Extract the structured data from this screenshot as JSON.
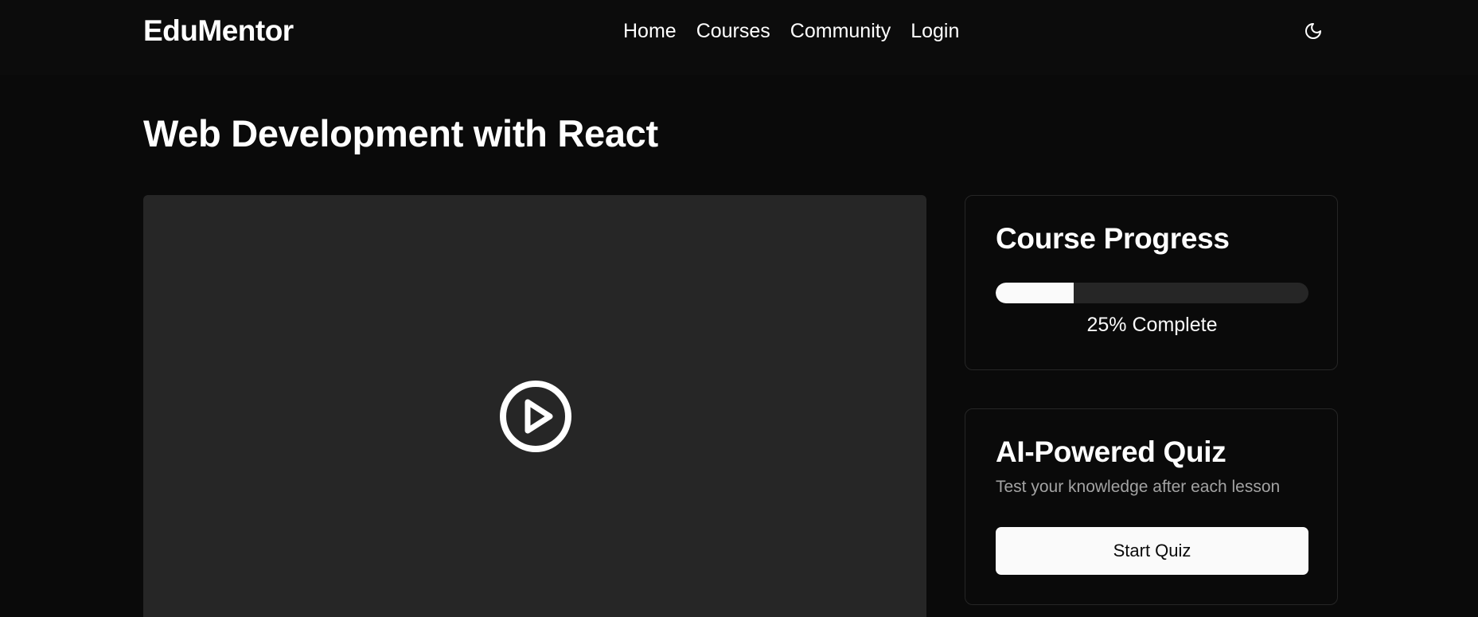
{
  "header": {
    "logo": "EduMentor",
    "nav": [
      {
        "label": "Home"
      },
      {
        "label": "Courses"
      },
      {
        "label": "Community"
      },
      {
        "label": "Login"
      }
    ],
    "theme_icon": "moon-icon"
  },
  "page": {
    "title": "Web Development with React"
  },
  "video": {
    "play_icon": "play-circle-icon"
  },
  "progress_card": {
    "title": "Course Progress",
    "percent": 25,
    "label": "25% Complete"
  },
  "quiz_card": {
    "title": "AI-Powered Quiz",
    "description": "Test your knowledge after each lesson",
    "button_label": "Start Quiz"
  },
  "colors": {
    "background": "#0a0a0a",
    "video_bg": "#262626",
    "track": "#262626",
    "fill": "#fafafa",
    "muted_text": "#a3a3a3"
  }
}
